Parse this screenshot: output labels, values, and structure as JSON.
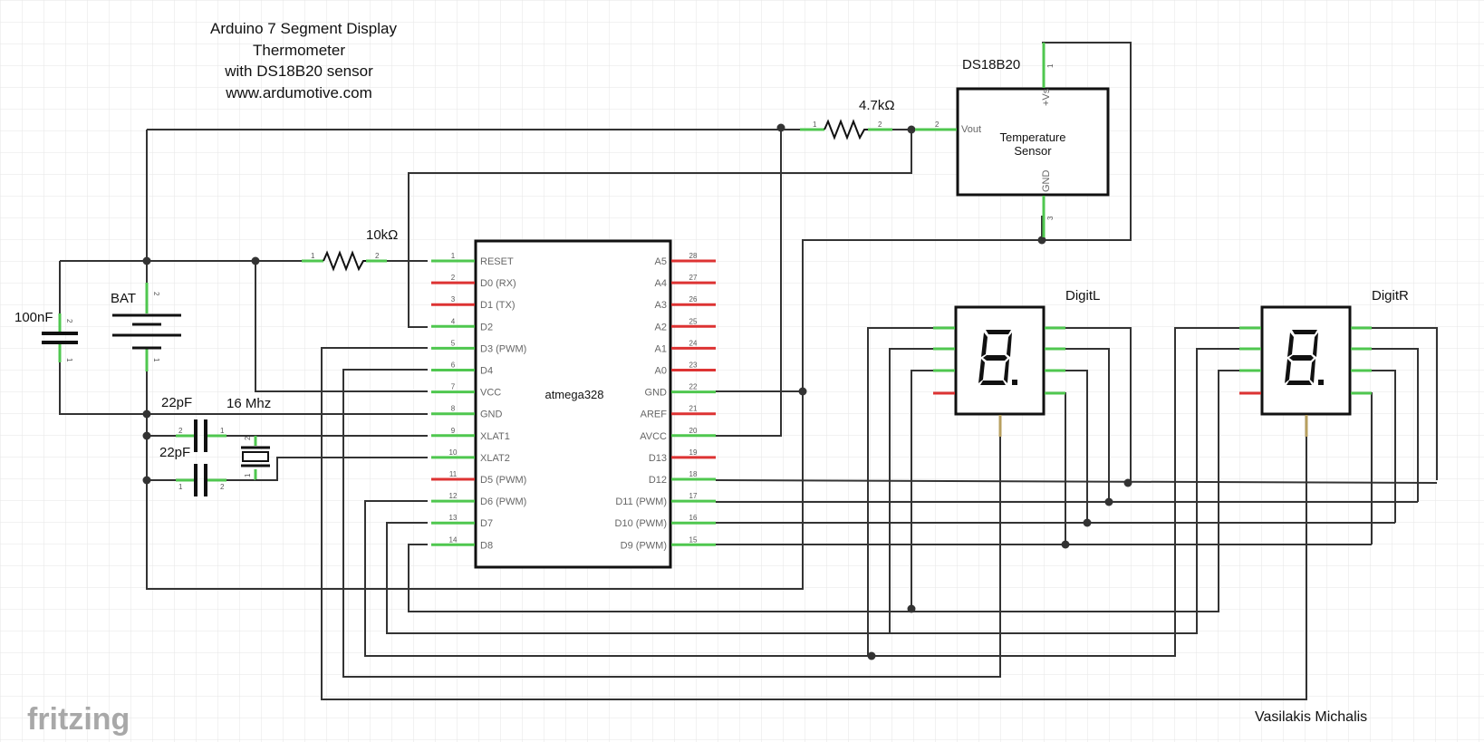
{
  "title": {
    "lines": [
      "Arduino 7 Segment Display",
      "Thermometer",
      "with DS18B20 sensor",
      "www.ardumotive.com"
    ]
  },
  "author": "Vasilakis Michalis",
  "logo": "fritzing",
  "components": {
    "mcu": {
      "name": "atmega328",
      "left_pins": [
        {
          "num": "1",
          "name": "RESET",
          "connected": true
        },
        {
          "num": "2",
          "name": "D0 (RX)",
          "connected": false
        },
        {
          "num": "3",
          "name": "D1 (TX)",
          "connected": false
        },
        {
          "num": "4",
          "name": "D2",
          "connected": true
        },
        {
          "num": "5",
          "name": "D3 (PWM)",
          "connected": true
        },
        {
          "num": "6",
          "name": "D4",
          "connected": true
        },
        {
          "num": "7",
          "name": "VCC",
          "connected": true
        },
        {
          "num": "8",
          "name": "GND",
          "connected": true
        },
        {
          "num": "9",
          "name": "XLAT1",
          "connected": true
        },
        {
          "num": "10",
          "name": "XLAT2",
          "connected": true
        },
        {
          "num": "11",
          "name": "D5 (PWM)",
          "connected": false
        },
        {
          "num": "12",
          "name": "D6 (PWM)",
          "connected": true
        },
        {
          "num": "13",
          "name": "D7",
          "connected": true
        },
        {
          "num": "14",
          "name": "D8",
          "connected": true
        }
      ],
      "right_pins": [
        {
          "num": "28",
          "name": "A5",
          "connected": false
        },
        {
          "num": "27",
          "name": "A4",
          "connected": false
        },
        {
          "num": "26",
          "name": "A3",
          "connected": false
        },
        {
          "num": "25",
          "name": "A2",
          "connected": false
        },
        {
          "num": "24",
          "name": "A1",
          "connected": false
        },
        {
          "num": "23",
          "name": "A0",
          "connected": false
        },
        {
          "num": "22",
          "name": "GND",
          "connected": true
        },
        {
          "num": "21",
          "name": "AREF",
          "connected": false
        },
        {
          "num": "20",
          "name": "AVCC",
          "connected": true
        },
        {
          "num": "19",
          "name": "D13",
          "connected": false
        },
        {
          "num": "18",
          "name": "D12",
          "connected": true
        },
        {
          "num": "17",
          "name": "D11 (PWM)",
          "connected": true
        },
        {
          "num": "16",
          "name": "D10 (PWM)",
          "connected": true
        },
        {
          "num": "15",
          "name": "D9 (PWM)",
          "connected": true
        }
      ]
    },
    "sensor": {
      "name": "DS18B20",
      "body_line1": "Temperature",
      "body_line2": "Sensor",
      "pin_vs": "+Vs",
      "pin_vout": "Vout",
      "pin_gnd": "GND",
      "pin_vs_num": "1",
      "pin_vout_num": "2",
      "pin_gnd_num": "3"
    },
    "r_pullup": {
      "label": "4.7kΩ",
      "pin1": "1",
      "pin2": "2"
    },
    "r_reset": {
      "label": "10kΩ",
      "pin1": "1",
      "pin2": "2"
    },
    "c_bypass": {
      "label": "100nF",
      "pin1": "1",
      "pin2": "2"
    },
    "battery": {
      "label": "BAT",
      "pin1": "1",
      "pin2": "2"
    },
    "c_xtal1": {
      "label": "22pF",
      "pin1": "1",
      "pin2": "2"
    },
    "c_xtal2": {
      "label": "22pF",
      "pin1": "1",
      "pin2": "2"
    },
    "crystal": {
      "label": "16 Mhz",
      "pin1": "1",
      "pin2": "2"
    },
    "digit_left": {
      "label": "DigitL"
    },
    "digit_right": {
      "label": "DigitR"
    }
  },
  "colors": {
    "wire": "#333333",
    "connected_pin": "#4fc74f",
    "unconnected_pin": "#dd3333",
    "grid": "#e6e6e6",
    "logo": "#a8a8a8"
  }
}
